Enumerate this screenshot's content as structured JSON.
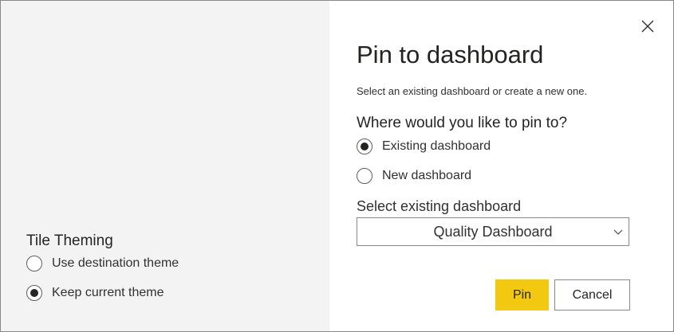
{
  "dialog": {
    "title": "Pin to dashboard",
    "subtitle": "Select an existing dashboard or create a new one.",
    "question": "Where would you like to pin to?",
    "pin_options": [
      {
        "label": "Existing dashboard",
        "checked": true
      },
      {
        "label": "New dashboard",
        "checked": false
      }
    ],
    "dropdown": {
      "label": "Select existing dashboard",
      "selected": "Quality Dashboard"
    },
    "buttons": {
      "pin": "Pin",
      "cancel": "Cancel"
    },
    "close_icon": "close-icon",
    "accent_color": "#f2c811"
  },
  "tile_theming": {
    "heading": "Tile Theming",
    "options": [
      {
        "label": "Use destination theme",
        "checked": false
      },
      {
        "label": "Keep current theme",
        "checked": true
      }
    ]
  }
}
